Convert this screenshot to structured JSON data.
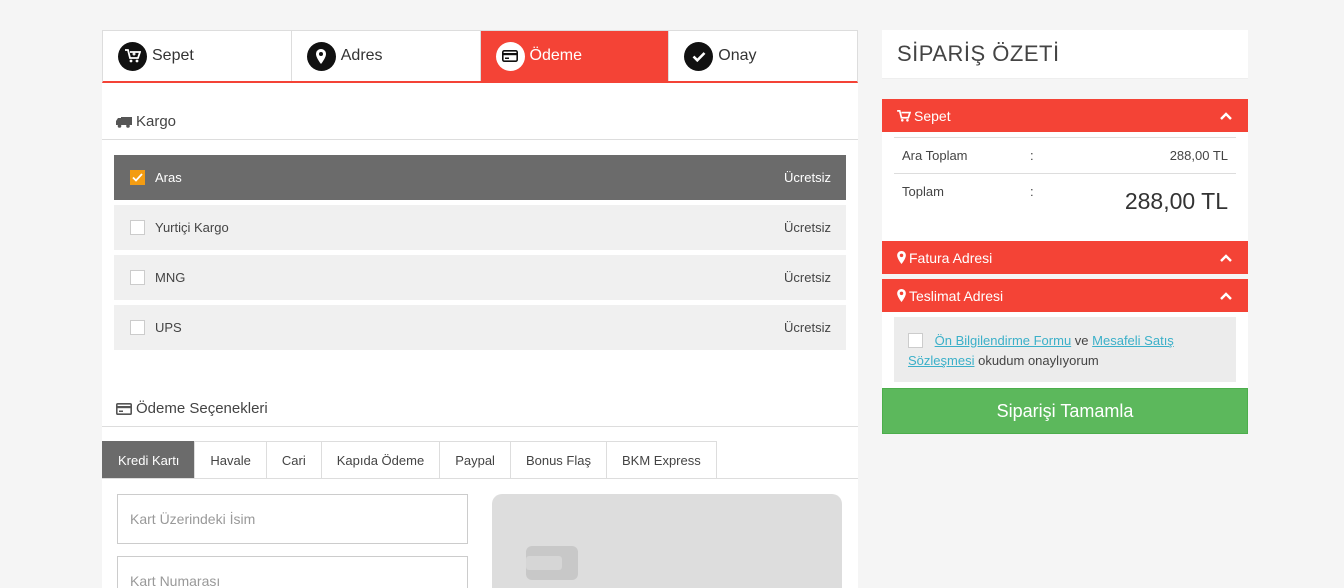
{
  "steps": [
    {
      "label": "Sepet",
      "icon": "cart-icon"
    },
    {
      "label": "Adres",
      "icon": "map-marker-icon"
    },
    {
      "label": "Ödeme",
      "icon": "credit-card-icon"
    },
    {
      "label": "Onay",
      "icon": "check-icon"
    }
  ],
  "active_step": "Ödeme",
  "kargo": {
    "title": "Kargo",
    "options": [
      {
        "name": "Aras",
        "price": "Ücretsiz",
        "selected": true
      },
      {
        "name": "Yurtiçi Kargo",
        "price": "Ücretsiz",
        "selected": false
      },
      {
        "name": "MNG",
        "price": "Ücretsiz",
        "selected": false
      },
      {
        "name": "UPS",
        "price": "Ücretsiz",
        "selected": false
      }
    ]
  },
  "payment": {
    "title": "Ödeme Seçenekleri",
    "tabs": [
      "Kredi Kartı",
      "Havale",
      "Cari",
      "Kapıda Ödeme",
      "Paypal",
      "Bonus Flaş",
      "BKM Express"
    ],
    "active_tab": "Kredi Kartı",
    "card_name_placeholder": "Kart Üzerindeki İsim",
    "card_number_placeholder": "Kart Numarası"
  },
  "summary": {
    "title": "SİPARİŞ ÖZETİ",
    "cart_bar": "Sepet",
    "subtotal_label": "Ara Toplam",
    "subtotal_value": "288,00 TL",
    "total_label": "Toplam",
    "total_value": "288,00 TL",
    "colon": ":",
    "billing_bar": "Fatura Adresi",
    "shipping_bar": "Teslimat Adresi",
    "agree_link1": "Ön Bilgilendirme Formu",
    "agree_and": "ve",
    "agree_link2": "Mesafeli Satış Sözleşmesi",
    "agree_tail": "okudum onaylıyorum",
    "complete_button": "Siparişi Tamamla"
  },
  "colors": {
    "accent": "#f44336",
    "selected_row": "#6b6b6b",
    "checkbox_checked": "#f39c12",
    "complete": "#5cb85c",
    "link": "#3bb0c9"
  }
}
